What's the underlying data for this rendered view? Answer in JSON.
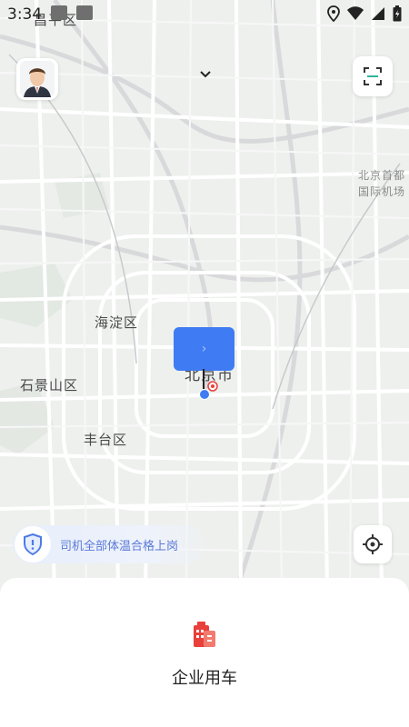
{
  "status_bar": {
    "time": "3:34"
  },
  "map": {
    "labels": {
      "changping": "昌平区",
      "airport_line1": "北京首都",
      "airport_line2": "国际机场",
      "haidian": "海淀区",
      "beijing": "北京市",
      "shijingshan": "石景山区",
      "fengtai": "丰台区"
    }
  },
  "pickup": {
    "arrow": "›"
  },
  "safety_banner": {
    "text": "司机全部体温合格上岗"
  },
  "bottom_sheet": {
    "service_label": "企业用车"
  },
  "colors": {
    "accent": "#3f7cf3",
    "service_icon": "#e8403a"
  }
}
